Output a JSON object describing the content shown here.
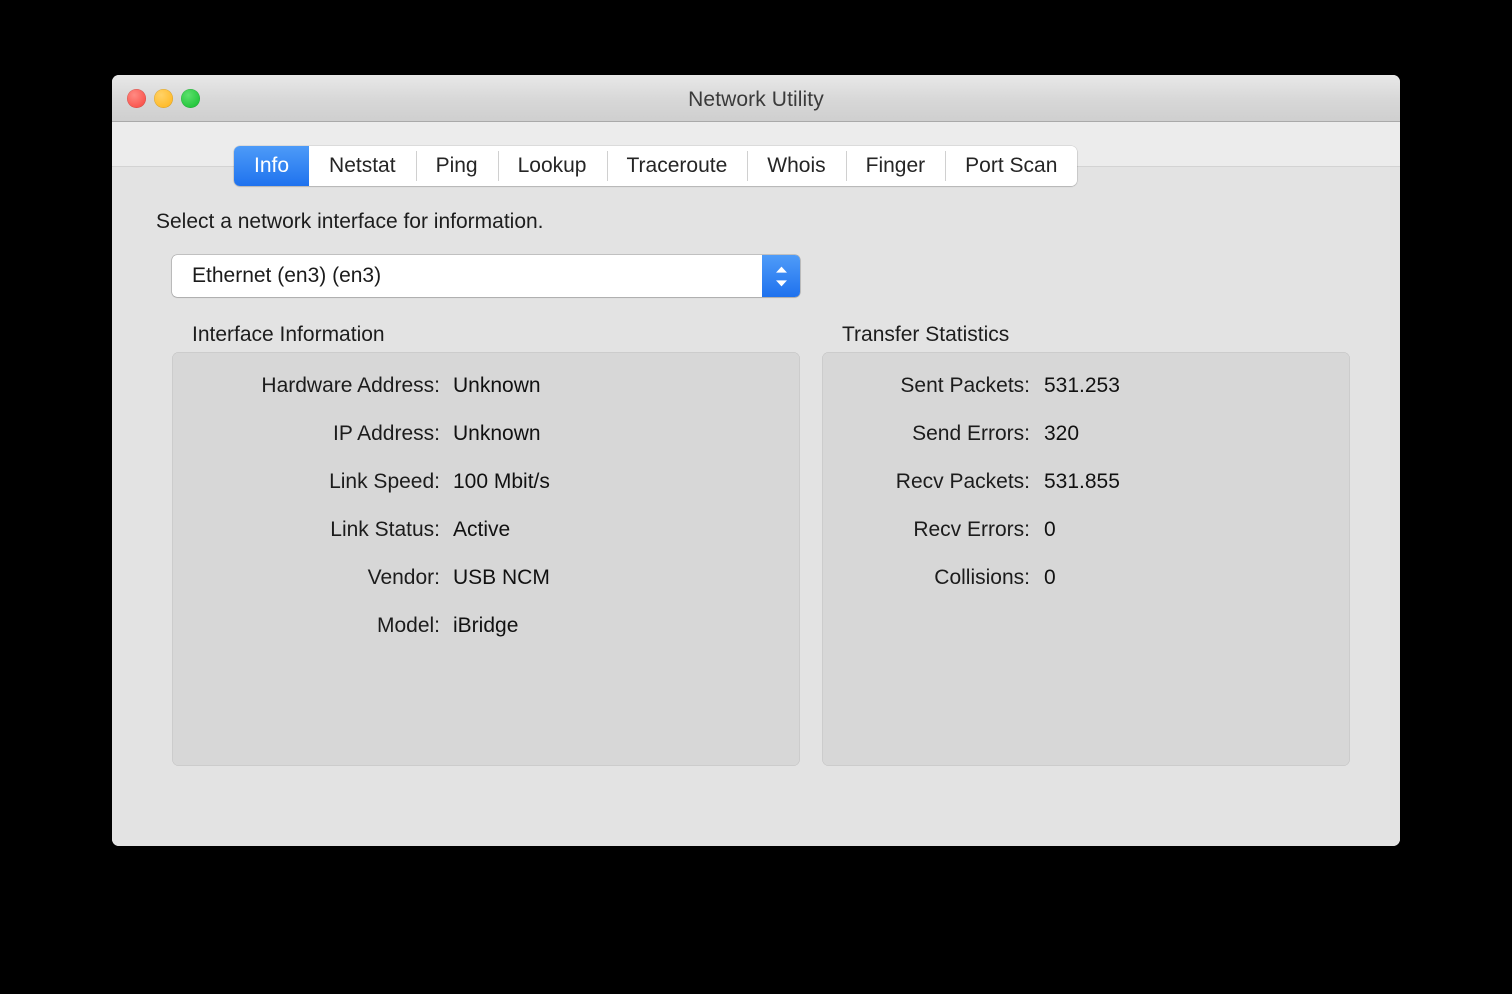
{
  "window": {
    "title": "Network Utility",
    "traffic_lights": [
      {
        "name": "close-button",
        "color": "#FA5750"
      },
      {
        "name": "minimize-button",
        "color": "#FFBC2D"
      },
      {
        "name": "maximize-button",
        "color": "#27C73F"
      }
    ]
  },
  "tabs": [
    {
      "label": "Info",
      "active": true
    },
    {
      "label": "Netstat",
      "active": false
    },
    {
      "label": "Ping",
      "active": false
    },
    {
      "label": "Lookup",
      "active": false
    },
    {
      "label": "Traceroute",
      "active": false
    },
    {
      "label": "Whois",
      "active": false
    },
    {
      "label": "Finger",
      "active": false
    },
    {
      "label": "Port Scan",
      "active": false
    }
  ],
  "main": {
    "prompt": "Select a network interface for information.",
    "interface_select": {
      "value": "Ethernet (en3) (en3)",
      "stepper_icon": "chevron-up-down-icon",
      "accent": "#1F72EE"
    },
    "interface_information": {
      "title": "Interface Information",
      "rows": [
        {
          "label": "Hardware Address:",
          "value": "Unknown"
        },
        {
          "label": "IP Address:",
          "value": "Unknown"
        },
        {
          "label": "Link Speed:",
          "value": "100 Mbit/s"
        },
        {
          "label": "Link Status:",
          "value": "Active"
        },
        {
          "label": "Vendor:",
          "value": "USB NCM"
        },
        {
          "label": "Model:",
          "value": "iBridge"
        }
      ]
    },
    "transfer_statistics": {
      "title": "Transfer Statistics",
      "rows": [
        {
          "label": "Sent Packets:",
          "value": "531.253"
        },
        {
          "label": "Send Errors:",
          "value": "320"
        },
        {
          "label": "Recv Packets:",
          "value": "531.855"
        },
        {
          "label": "Recv Errors:",
          "value": "0"
        },
        {
          "label": "Collisions:",
          "value": "0"
        }
      ]
    }
  },
  "colors": {
    "window_bg": "#E3E3E3",
    "panel_bg": "#D7D7D7",
    "toolbar_bg": "#ECECEC",
    "accent_blue": "#1F72EE"
  }
}
